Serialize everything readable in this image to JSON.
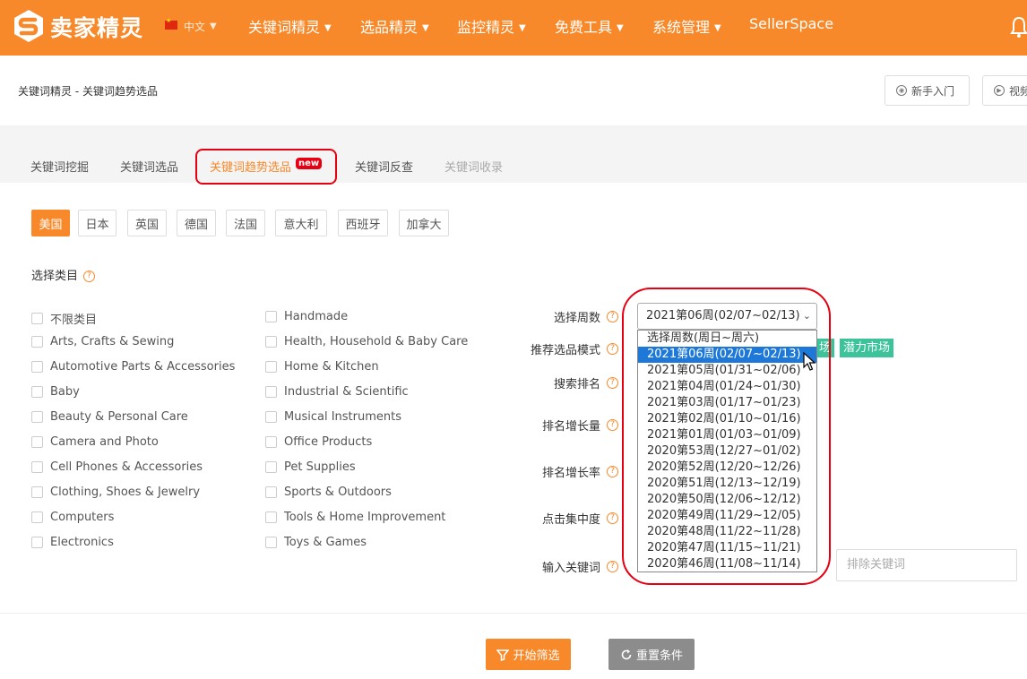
{
  "header": {
    "brand": "卖家精灵",
    "language": "中文",
    "nav": [
      "关键词精灵",
      "选品精灵",
      "监控精灵",
      "免费工具",
      "系统管理"
    ],
    "seller_space": "SellerSpace"
  },
  "breadcrumb": "关键词精灵 - 关键词趋势选品",
  "top_buttons": {
    "guide": "新手入门",
    "video": "视频"
  },
  "tabs": [
    "关键词挖掘",
    "关键词选品",
    "关键词趋势选品",
    "关键词反查",
    "关键词收录"
  ],
  "new_badge": "new",
  "countries": [
    "美国",
    "日本",
    "英国",
    "德国",
    "法国",
    "意大利",
    "西班牙",
    "加拿大"
  ],
  "category_section_label": "选择类目",
  "categories_left": [
    "不限类目",
    "Arts, Crafts & Sewing",
    "Automotive Parts & Accessories",
    "Baby",
    "Beauty & Personal Care",
    "Camera and Photo",
    "Cell Phones & Accessories",
    "Clothing, Shoes & Jewelry",
    "Computers",
    "Electronics"
  ],
  "categories_right": [
    "Handmade",
    "Health, Household & Baby Care",
    "Home & Kitchen",
    "Industrial & Scientific",
    "Musical Instruments",
    "Office Products",
    "Pet Supplies",
    "Sports & Outdoors",
    "Tools & Home Improvement",
    "Toys & Games"
  ],
  "filters": {
    "week_label": "选择周数",
    "mode_label": "推荐选品模式",
    "rank_label": "搜索排名",
    "rank_growth_label": "排名增长量",
    "rank_growth_rate_label": "排名增长率",
    "click_concentration_label": "点击集中度",
    "keyword_label": "输入关键词"
  },
  "week_select": {
    "selected": "2021第06周(02/07~02/13)",
    "options": [
      "选择周数(周日~周六)",
      "2021第06周(02/07~02/13)",
      "2021第05周(01/31~02/06)",
      "2021第04周(01/24~01/30)",
      "2021第03周(01/17~01/23)",
      "2021第02周(01/10~01/16)",
      "2021第01周(01/03~01/09)",
      "2020第53周(12/27~01/02)",
      "2020第52周(12/20~12/26)",
      "2020第51周(12/13~12/19)",
      "2020第50周(12/06~12/12)",
      "2020第49周(11/29~12/05)",
      "2020第48周(11/22~11/28)",
      "2020第47周(11/15~11/21)",
      "2020第46周(11/08~11/14)"
    ]
  },
  "mode_tags": {
    "partial": "场",
    "potential_market": "潜力市场"
  },
  "exclude_placeholder": "排除关键词",
  "actions": {
    "start": "开始筛选",
    "reset": "重置条件"
  },
  "colors": {
    "brand_orange": "#f7892a",
    "highlight_red": "#e60012",
    "tag_green": "#3cc39a",
    "select_blue": "#1e78d7",
    "reset_gray": "#8c8c8c"
  }
}
